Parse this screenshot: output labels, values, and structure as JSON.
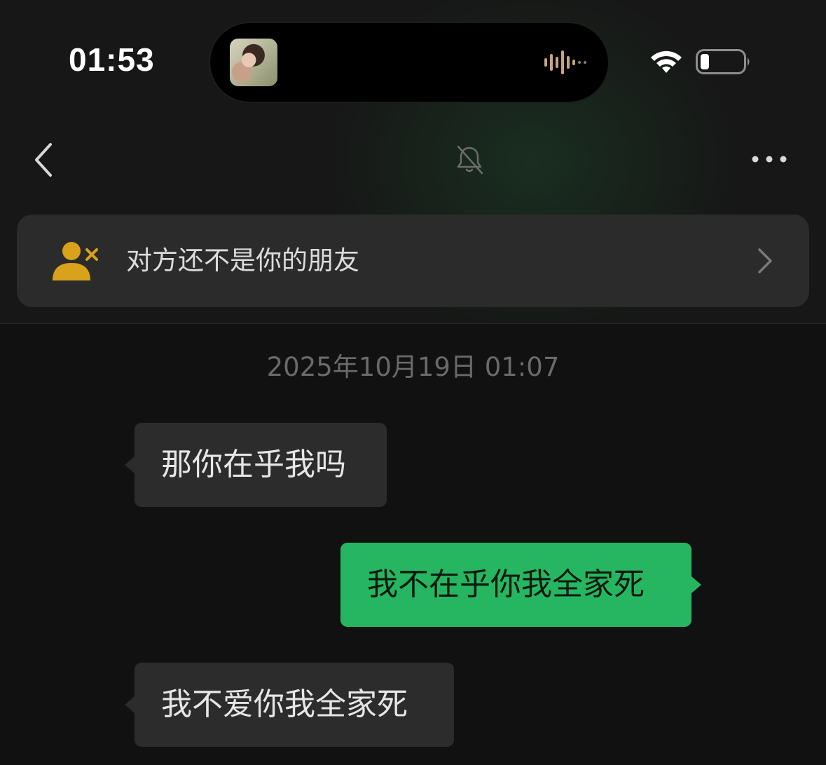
{
  "status_bar": {
    "time": "01:53",
    "album_art_icon": "album-art-thumbnail",
    "waveform_icon": "audio-waveform-icon",
    "wifi_icon": "wifi-icon",
    "battery_icon": "battery-low-icon",
    "waveform_color": "#c8a57a"
  },
  "nav": {
    "back_icon": "chevron-left-icon",
    "mute_icon": "bell-slash-icon",
    "more_icon": "more-dots-icon"
  },
  "banner": {
    "text": "对方还不是你的朋友",
    "icon": "user-remove-icon",
    "icon_color": "#d9a21b",
    "chevron_icon": "chevron-right-icon"
  },
  "chat": {
    "timestamp": "2025年10月19日 01:07",
    "messages": [
      {
        "direction": "incoming",
        "text": "那你在乎我吗"
      },
      {
        "direction": "outgoing",
        "text": "我不在乎你我全家死"
      },
      {
        "direction": "incoming",
        "text": "我不爱你我全家死"
      }
    ],
    "outgoing_color": "#26b661",
    "incoming_color": "#2c2c2c"
  }
}
